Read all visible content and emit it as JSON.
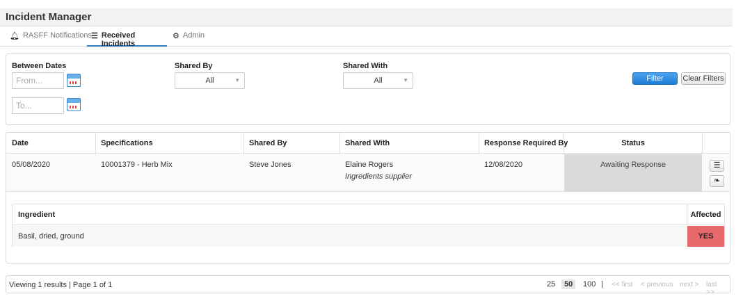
{
  "app": {
    "title": "Incident Manager"
  },
  "tabs": [
    {
      "label": "RASFF Notifications",
      "icon": "bell-icon"
    },
    {
      "label": "Received Incidents",
      "icon": "list-icon",
      "active": true
    },
    {
      "label": "Admin",
      "icon": "gear-icon"
    }
  ],
  "filters": {
    "between_dates_label": "Between Dates",
    "from_placeholder": "From...",
    "to_placeholder": "To...",
    "shared_by_label": "Shared By",
    "shared_by_value": "All",
    "shared_with_label": "Shared With",
    "shared_with_value": "All",
    "filter_button": "Filter",
    "clear_button": "Clear Filters"
  },
  "table": {
    "headers": [
      "Date",
      "Specifications",
      "Shared By",
      "Shared With",
      "Response Required By",
      "Status"
    ],
    "rows": [
      {
        "date": "05/08/2020",
        "specification": "10001379 - Herb Mix",
        "shared_by": "Steve Jones",
        "shared_with": "Elaine Rogers",
        "shared_with_role": "Ingredients supplier",
        "response_required_by": "12/08/2020",
        "status": "Awaiting Response"
      }
    ]
  },
  "ingredients": {
    "headers": [
      "Ingredient",
      "Affected"
    ],
    "rows": [
      {
        "ingredient": "Basil, dried, ground",
        "affected": "YES"
      }
    ]
  },
  "pager": {
    "info": "Viewing 1 results | Page 1 of 1",
    "sizes": [
      "25",
      "50",
      "100"
    ],
    "selected_size": "50",
    "separator": "|",
    "first": "<< first",
    "previous": "< previous",
    "next": "next >",
    "last": "last >>"
  },
  "colors": {
    "accent": "#2a7bc8",
    "affected_yes": "#e8696b",
    "status_bg": "#d9d9d9"
  }
}
